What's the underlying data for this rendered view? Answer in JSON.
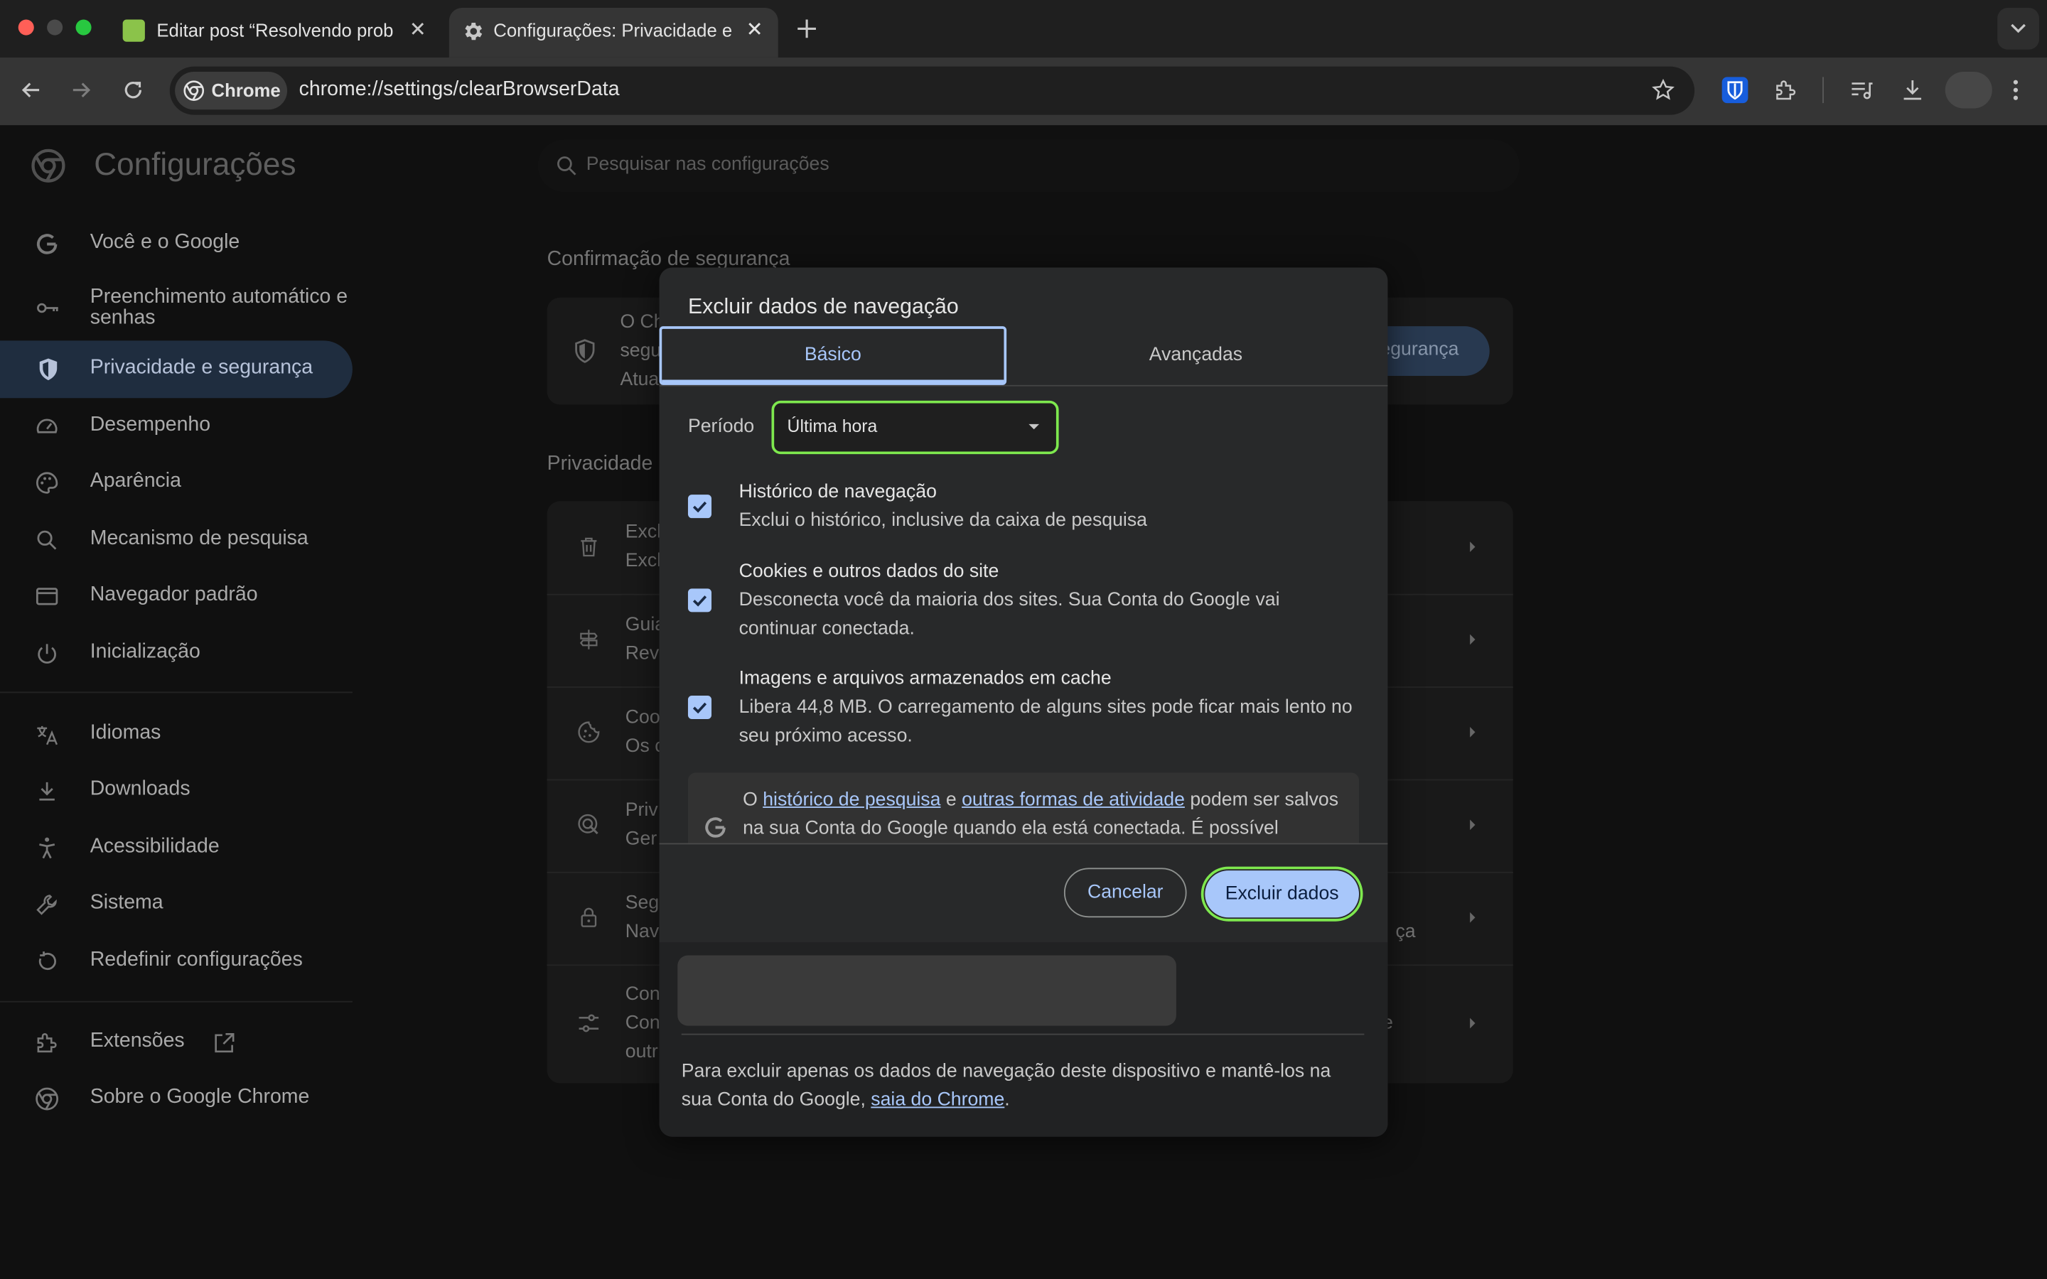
{
  "browser": {
    "tabs": [
      {
        "title": "Editar post “Resolvendo prob",
        "icon": "wordpress-favicon-icon"
      },
      {
        "title": "Configurações: Privacidade e",
        "icon": "gear-icon"
      }
    ],
    "address": {
      "chip_label": "Chrome",
      "url": "chrome://settings/clearBrowserData"
    }
  },
  "settings": {
    "title": "Configurações",
    "search_placeholder": "Pesquisar nas configurações",
    "sidebar": [
      {
        "label": "Você e o Google",
        "icon": "google-g-icon"
      },
      {
        "label": "Preenchimento automático e senhas",
        "icon": "key-icon"
      },
      {
        "label": "Privacidade e segurança",
        "icon": "shield-icon",
        "active": true
      },
      {
        "label": "Desempenho",
        "icon": "speedometer-icon"
      },
      {
        "label": "Aparência",
        "icon": "palette-icon"
      },
      {
        "label": "Mecanismo de pesquisa",
        "icon": "search-icon"
      },
      {
        "label": "Navegador padrão",
        "icon": "browser-window-icon"
      },
      {
        "label": "Inicialização",
        "icon": "power-icon"
      },
      {
        "label": "Idiomas",
        "icon": "translate-icon"
      },
      {
        "label": "Downloads",
        "icon": "download-icon"
      },
      {
        "label": "Acessibilidade",
        "icon": "accessibility-icon"
      },
      {
        "label": "Sistema",
        "icon": "wrench-icon"
      },
      {
        "label": "Redefinir configurações",
        "icon": "reset-icon"
      }
    ],
    "extensions_label": "Extensões",
    "about_label": "Sobre o Google Chrome",
    "safety_heading": "Confirmação de segurança",
    "safety_card": {
      "line1": "O Ch",
      "line2": "segu",
      "line3": "Atua",
      "button_label": "egurança"
    },
    "privacy_heading": "Privacidade",
    "privacy_rows": [
      {
        "line1": "Excl",
        "line2": "Excl",
        "icon": "trash-icon"
      },
      {
        "line1": "Guia",
        "line2": "Rev",
        "icon": "signpost-icon"
      },
      {
        "line1": "Coo",
        "line2": "Os c",
        "icon": "cookie-icon"
      },
      {
        "line1": "Priv",
        "line2": "Ger",
        "icon": "privacy-sandbox-icon"
      },
      {
        "line1": "Seg",
        "line2": "Nav",
        "trailing": "ça",
        "icon": "lock-icon"
      },
      {
        "line1": "Con",
        "line2": "Con",
        "line3": "outr",
        "trailing": "e",
        "icon": "sliders-icon"
      }
    ]
  },
  "dialog": {
    "title": "Excluir dados de navegação",
    "tabs": [
      {
        "label": "Básico"
      },
      {
        "label": "Avançadas"
      }
    ],
    "period_label": "Período",
    "period_value": "Última hora",
    "items": [
      {
        "title": "Histórico de navegação",
        "desc": "Exclui o histórico, inclusive da caixa de pesquisa",
        "checked": true
      },
      {
        "title": "Cookies e outros dados do site",
        "desc": "Desconecta você da maioria dos sites. Sua Conta do Google vai continuar conectada.",
        "checked": true
      },
      {
        "title": "Imagens e arquivos armazenados em cache",
        "desc": "Libera 44,8 MB. O carregamento de alguns sites pode ficar mais lento no seu próximo acesso.",
        "checked": true
      }
    ],
    "notice": {
      "prefix": "O ",
      "link1": "histórico de pesquisa",
      "mid": " e ",
      "link2": "outras formas de atividade",
      "suffix": " podem ser salvos na sua Conta do Google quando ela está conectada. É possível"
    },
    "cancel_label": "Cancelar",
    "confirm_label": "Excluir dados",
    "footer": {
      "text": "Para excluir apenas os dados de navegação deste dispositivo e mantê-los na sua Conta do Google, ",
      "link": "saia do Chrome",
      "end": "."
    }
  }
}
